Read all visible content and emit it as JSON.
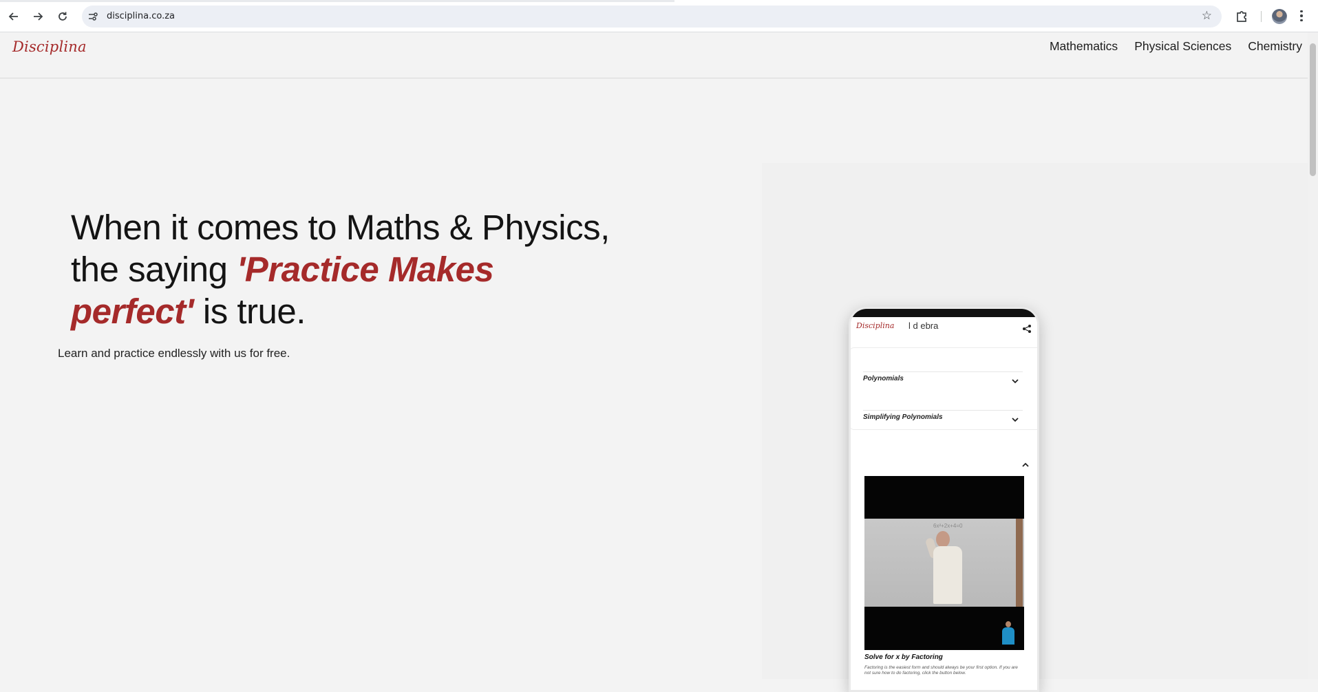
{
  "browser": {
    "url": "disciplina.co.za"
  },
  "site": {
    "logo": "Disciplina",
    "nav": [
      "Mathematics",
      "Physical Sciences",
      "Chemistry"
    ]
  },
  "hero": {
    "line1": "When it comes to Maths & Physics,",
    "line2_prefix": "the saying ",
    "accent_1": "'Practice Makes",
    "accent_2": "perfect'",
    "line3_suffix": " is true.",
    "subtitle": "Learn and practice endlessly with us for free."
  },
  "phone": {
    "logo": "Disciplina",
    "topbar_title": "l        d  ebra",
    "accordion": [
      {
        "label": "Polynomials"
      },
      {
        "label": "Simplifying Polynomials"
      }
    ],
    "video_caption": "Solve for x by Factoring",
    "video_description": "Factoring is the easiest form and should always be your first option. If you are not sure how to do factoring, click the button below.",
    "board_text": "6x²+2x+4=0"
  },
  "colors": {
    "accent": "#a52a2a",
    "page_bg": "#f3f3f3"
  }
}
